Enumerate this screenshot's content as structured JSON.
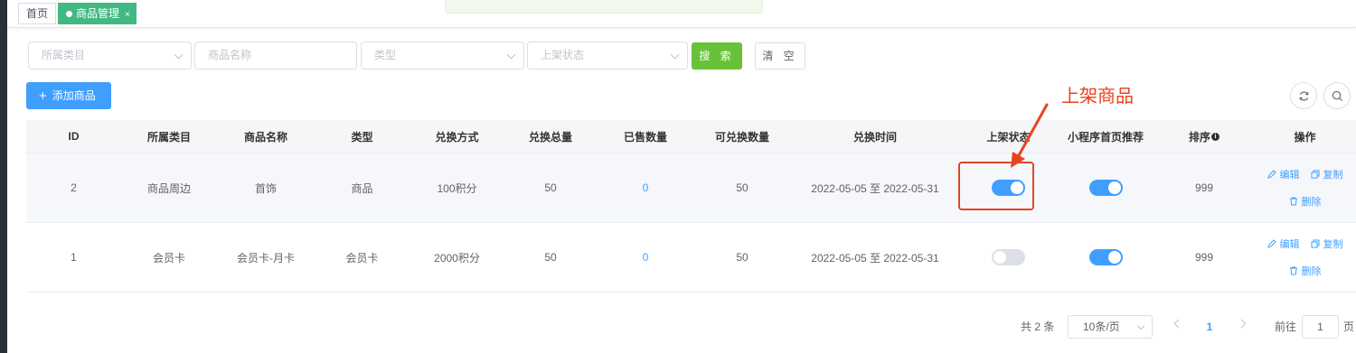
{
  "tabs": {
    "home": "首页",
    "active": "商品管理",
    "close": "×"
  },
  "filters": {
    "category": "所属类目",
    "name": "商品名称",
    "type": "类型",
    "status": "上架状态",
    "search": "搜 索",
    "clear": "清 空"
  },
  "toolbar": {
    "add_icon": "+",
    "add": "添加商品"
  },
  "annotation": {
    "text": "上架商品",
    "color": "#e8431f"
  },
  "table": {
    "headers": [
      "ID",
      "所属类目",
      "商品名称",
      "类型",
      "兑换方式",
      "兑换总量",
      "已售数量",
      "可兑换数量",
      "兑换时间",
      "上架状态",
      "小程序首页推荐",
      "排序",
      "操作"
    ],
    "sort_info_icon": "i",
    "rows": [
      {
        "id": "2",
        "category": "商品周边",
        "name": "首饰",
        "type": "商品",
        "exchange": "100积分",
        "total": "50",
        "sold": "0",
        "available": "50",
        "time": "2022-05-05 至 2022-05-31",
        "on_shelf": true,
        "recommend": true,
        "sort": "999"
      },
      {
        "id": "1",
        "category": "会员卡",
        "name": "会员卡-月卡",
        "type": "会员卡",
        "exchange": "2000积分",
        "total": "50",
        "sold": "0",
        "available": "50",
        "time": "2022-05-05 至 2022-05-31",
        "on_shelf": false,
        "recommend": true,
        "sort": "999"
      }
    ],
    "ops": {
      "edit": "编辑",
      "copy": "复制",
      "delete": "删除"
    }
  },
  "pagination": {
    "total_text": "共 2 条",
    "page_size": "10条/页",
    "current": "1",
    "goto_label": "前往",
    "goto_value": "1",
    "page_suffix": "页"
  },
  "colors": {
    "primary": "#409eff",
    "success": "#67c23a",
    "tab_active": "#42b983"
  }
}
